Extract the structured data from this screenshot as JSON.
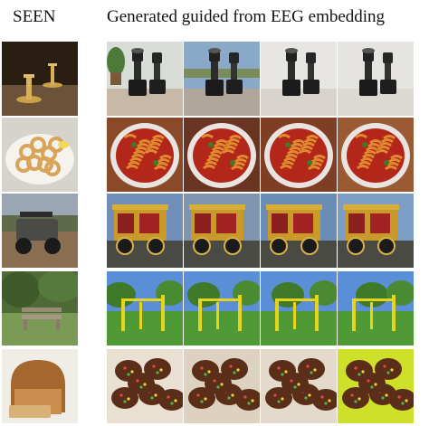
{
  "headers": {
    "seen": "SEEN",
    "generated": "Generated guided from EEG embedding"
  },
  "rows": [
    {
      "subject": "espresso-machine",
      "seen_subject": "brass-candlesticks"
    },
    {
      "subject": "pasta-bowl",
      "seen_subject": "fried-calamari"
    },
    {
      "subject": "steam-carriage",
      "seen_subject": "utility-vehicle"
    },
    {
      "subject": "yellow-frame-structure",
      "seen_subject": "park-bench"
    },
    {
      "subject": "sprinkled-cookies",
      "seen_subject": "bread-loaf"
    }
  ]
}
